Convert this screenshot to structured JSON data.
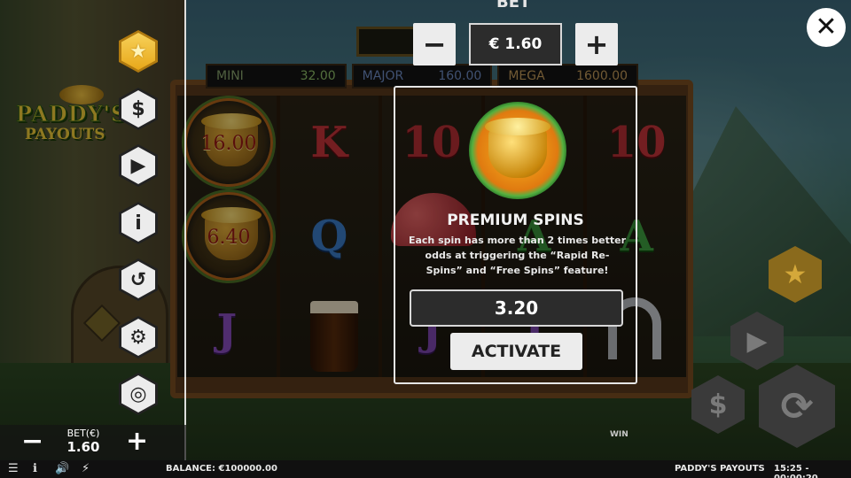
{
  "header": {
    "bet_title": "BET",
    "bet_minus": "−",
    "bet_plus": "+",
    "bet_value": "€ 1.60",
    "close_icon": "✕"
  },
  "logo": {
    "line1": "PADDY'S",
    "line2": "PAYOUTS"
  },
  "jackpots": [
    {
      "label": "MINI",
      "value": "32.00"
    },
    {
      "label": "MAJOR",
      "value": "160.00"
    },
    {
      "label": "MEGA",
      "value": "1600.00"
    }
  ],
  "reels": {
    "pot_values": [
      "16.00",
      "6.40"
    ],
    "symbols": {
      "k": "K",
      "q": "Q",
      "j": "J",
      "ten": "10",
      "a": "A"
    }
  },
  "sidebar": {
    "items": [
      {
        "name": "star-icon",
        "glyph": "★"
      },
      {
        "name": "dollar-icon",
        "glyph": "$"
      },
      {
        "name": "play-icon",
        "glyph": "▶"
      },
      {
        "name": "info-icon",
        "glyph": "i"
      },
      {
        "name": "history-icon",
        "glyph": "↺"
      },
      {
        "name": "gear-icon",
        "glyph": "⚙"
      },
      {
        "name": "turbo-icon",
        "glyph": "◎"
      }
    ]
  },
  "premium": {
    "title": "PREMIUM SPINS",
    "description": "Each spin has more than 2 times better odds at triggering the “Rapid Re-Spins” and “Free Spins” feature!",
    "price": "3.20",
    "activate_label": "ACTIVATE"
  },
  "controls": {
    "star": "★",
    "play": "▶",
    "dollar": "$",
    "spin": "⟳",
    "win_label": "WIN"
  },
  "bottom_bet": {
    "minus": "−",
    "plus": "+",
    "label": "BET(€)",
    "value": "1.60"
  },
  "statusbar": {
    "icons": {
      "menu": "☰",
      "info": "ℹ",
      "sound": "🔊",
      "bolt": "⚡"
    },
    "balance": "BALANCE: €100000.00",
    "game_name": "PADDY'S PAYOUTS",
    "time": "15:25 - 00:00:20"
  }
}
